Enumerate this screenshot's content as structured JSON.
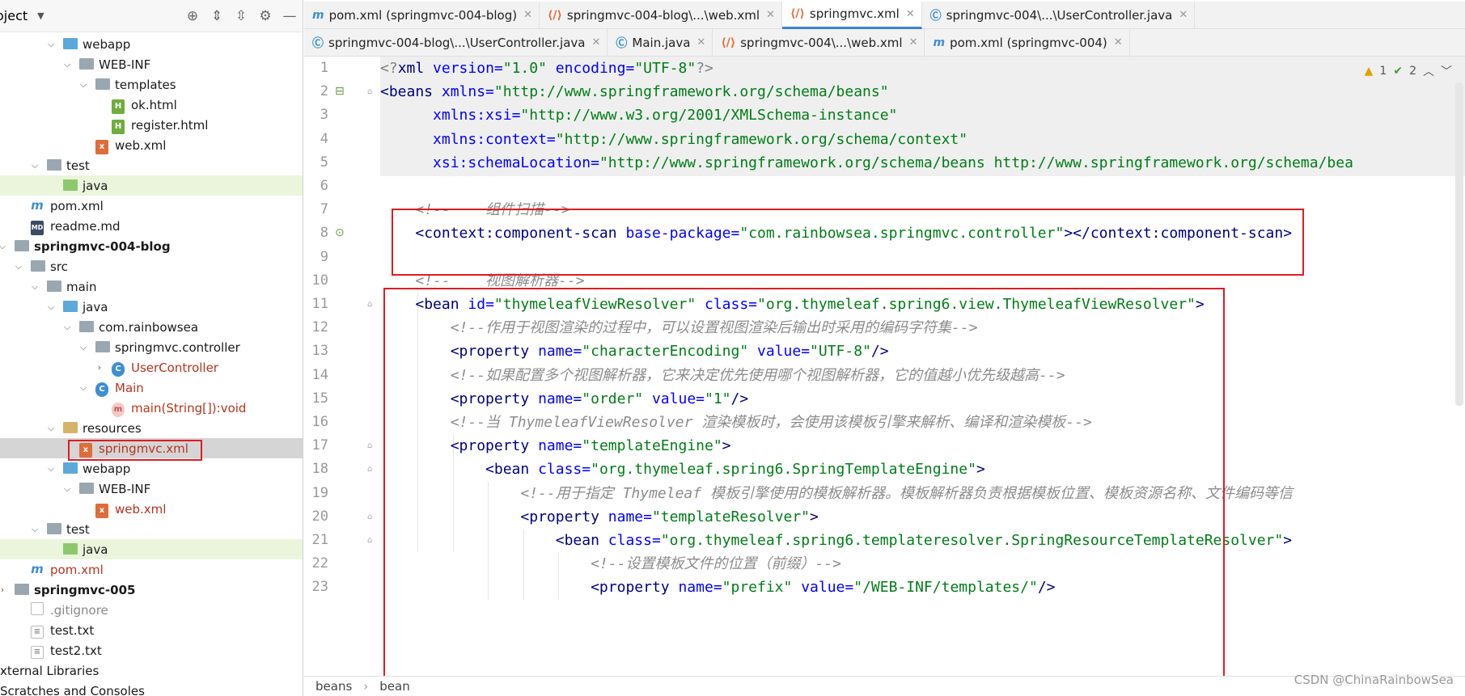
{
  "project_panel": {
    "title": "oject",
    "tree": [
      {
        "label": "webapp",
        "depth": 2,
        "kind": "folder-web",
        "arrow": "open"
      },
      {
        "label": "WEB-INF",
        "depth": 3,
        "kind": "folder",
        "arrow": "open"
      },
      {
        "label": "templates",
        "depth": 4,
        "kind": "folder",
        "arrow": "open"
      },
      {
        "label": "ok.html",
        "depth": 5,
        "kind": "html"
      },
      {
        "label": "register.html",
        "depth": 5,
        "kind": "html"
      },
      {
        "label": "web.xml",
        "depth": 4,
        "kind": "xml"
      },
      {
        "label": "test",
        "depth": 1,
        "kind": "folder",
        "arrow": "open"
      },
      {
        "label": "java",
        "depth": 2,
        "kind": "folder-green",
        "highlight": true
      },
      {
        "label": "pom.xml",
        "depth": 0,
        "kind": "maven"
      },
      {
        "label": "readme.md",
        "depth": 0,
        "kind": "md"
      },
      {
        "label": "springmvc-004-blog",
        "depth": -1,
        "kind": "module",
        "bold": true,
        "arrow": "open"
      },
      {
        "label": "src",
        "depth": 0,
        "kind": "folder",
        "arrow": "open"
      },
      {
        "label": "main",
        "depth": 1,
        "kind": "folder",
        "arrow": "open"
      },
      {
        "label": "java",
        "depth": 2,
        "kind": "folder-blue",
        "arrow": "open"
      },
      {
        "label": "com.rainbowsea",
        "depth": 3,
        "kind": "package",
        "arrow": "open"
      },
      {
        "label": "springmvc.controller",
        "depth": 4,
        "kind": "package",
        "arrow": "open"
      },
      {
        "label": "UserController",
        "depth": 5,
        "kind": "class",
        "red": true,
        "arrow": "closed"
      },
      {
        "label": "Main",
        "depth": 4,
        "kind": "class-main",
        "red": true,
        "arrow": "open"
      },
      {
        "label": "main(String[]):void",
        "depth": 5,
        "kind": "method",
        "red": true
      },
      {
        "label": "resources",
        "depth": 2,
        "kind": "folder-res",
        "arrow": "open"
      },
      {
        "label": "springmvc.xml",
        "depth": 3,
        "kind": "xml",
        "red": true,
        "selected": true
      },
      {
        "label": "webapp",
        "depth": 2,
        "kind": "folder-web",
        "arrow": "open"
      },
      {
        "label": "WEB-INF",
        "depth": 3,
        "kind": "folder",
        "arrow": "open"
      },
      {
        "label": "web.xml",
        "depth": 4,
        "kind": "xml",
        "red": true
      },
      {
        "label": "test",
        "depth": 1,
        "kind": "folder",
        "arrow": "open"
      },
      {
        "label": "java",
        "depth": 2,
        "kind": "folder-green",
        "highlight": true
      },
      {
        "label": "pom.xml",
        "depth": 0,
        "kind": "maven",
        "red": true
      },
      {
        "label": "springmvc-005",
        "depth": -1,
        "kind": "module",
        "bold": true,
        "arrow": "closed"
      },
      {
        "label": ".gitignore",
        "depth": 0,
        "kind": "file",
        "gray": true
      },
      {
        "label": "test.txt",
        "depth": 0,
        "kind": "txt"
      },
      {
        "label": "test2.txt",
        "depth": 0,
        "kind": "txt"
      },
      {
        "label": "xternal Libraries",
        "depth": -1,
        "kind": "none",
        "arrow": "closed"
      },
      {
        "label": "Scratches and Consoles",
        "depth": -1,
        "kind": "none"
      }
    ]
  },
  "tabs_row1": [
    {
      "label": "pom.xml (springmvc-004-blog)",
      "icon": "m"
    },
    {
      "label": "springmvc-004-blog\\...\\web.xml",
      "icon": "x"
    },
    {
      "label": "springmvc.xml",
      "icon": "x",
      "active": true
    },
    {
      "label": "springmvc-004\\...\\UserController.java",
      "icon": "c"
    }
  ],
  "tabs_row2": [
    {
      "label": "springmvc-004-blog\\...\\UserController.java",
      "icon": "c"
    },
    {
      "label": "Main.java",
      "icon": "c"
    },
    {
      "label": "springmvc-004\\...\\web.xml",
      "icon": "x"
    },
    {
      "label": "pom.xml (springmvc-004)",
      "icon": "m"
    }
  ],
  "inspections": {
    "warnings": "1",
    "weak": "2"
  },
  "code_lines": [
    {
      "n": "1",
      "indent": 0,
      "tokens": [
        [
          "pi",
          "<?"
        ],
        [
          "tag",
          "xml "
        ],
        [
          "an",
          "version="
        ],
        [
          "av",
          "\"1.0\""
        ],
        [
          "tag",
          " "
        ],
        [
          "an",
          "encoding="
        ],
        [
          "av",
          "\"UTF-8\""
        ],
        [
          "pi",
          "?>"
        ]
      ]
    },
    {
      "n": "2",
      "indent": 0,
      "tokens": [
        [
          "tag",
          "<beans "
        ],
        [
          "an",
          "xmlns="
        ],
        [
          "av",
          "\"http://www.springframework.org/schema/beans\""
        ]
      ]
    },
    {
      "n": "3",
      "indent": 6,
      "tokens": [
        [
          "an",
          "xmlns:xsi="
        ],
        [
          "av",
          "\"http://www.w3.org/2001/XMLSchema-instance\""
        ]
      ]
    },
    {
      "n": "4",
      "indent": 6,
      "tokens": [
        [
          "an",
          "xmlns:context="
        ],
        [
          "av",
          "\"http://www.springframework.org/schema/context\""
        ]
      ]
    },
    {
      "n": "5",
      "indent": 6,
      "tokens": [
        [
          "an",
          "xsi:schemaLocation="
        ],
        [
          "av",
          "\"http://www.springframework.org/schema/beans http://www.springframework.org/schema/bea"
        ]
      ]
    },
    {
      "n": "6",
      "indent": 0,
      "tokens": []
    },
    {
      "n": "7",
      "indent": 4,
      "tokens": [
        [
          "cm",
          "<!--    组件扫描-->"
        ]
      ]
    },
    {
      "n": "8",
      "indent": 4,
      "tokens": [
        [
          "tag",
          "<context:component-scan "
        ],
        [
          "an",
          "base-package="
        ],
        [
          "av",
          "\"com.rainbowsea.springmvc.controller\""
        ],
        [
          "tag",
          "></context:component-scan>"
        ]
      ]
    },
    {
      "n": "9",
      "indent": 0,
      "tokens": []
    },
    {
      "n": "10",
      "indent": 4,
      "tokens": [
        [
          "cm",
          "<!--    视图解析器-->"
        ]
      ]
    },
    {
      "n": "11",
      "indent": 4,
      "tokens": [
        [
          "tag",
          "<bean "
        ],
        [
          "an",
          "id="
        ],
        [
          "av",
          "\"thymeleafViewResolver\""
        ],
        [
          "tag",
          " "
        ],
        [
          "an",
          "class="
        ],
        [
          "av",
          "\"org.thymeleaf.spring6.view.ThymeleafViewResolver\""
        ],
        [
          "tag",
          ">"
        ]
      ]
    },
    {
      "n": "12",
      "indent": 8,
      "tokens": [
        [
          "cm",
          "<!--作用于视图渲染的过程中，可以设置视图渲染后输出时采用的编码字符集-->"
        ]
      ]
    },
    {
      "n": "13",
      "indent": 8,
      "tokens": [
        [
          "tag",
          "<property "
        ],
        [
          "an",
          "name="
        ],
        [
          "av",
          "\"characterEncoding\""
        ],
        [
          "tag",
          " "
        ],
        [
          "an",
          "value="
        ],
        [
          "av",
          "\"UTF-8\""
        ],
        [
          "tag",
          "/>"
        ]
      ]
    },
    {
      "n": "14",
      "indent": 8,
      "tokens": [
        [
          "cm",
          "<!--如果配置多个视图解析器，它来决定优先使用哪个视图解析器，它的值越小优先级越高-->"
        ]
      ]
    },
    {
      "n": "15",
      "indent": 8,
      "tokens": [
        [
          "tag",
          "<property "
        ],
        [
          "an",
          "name="
        ],
        [
          "av",
          "\"order\""
        ],
        [
          "tag",
          " "
        ],
        [
          "an",
          "value="
        ],
        [
          "av",
          "\"1\""
        ],
        [
          "tag",
          "/>"
        ]
      ]
    },
    {
      "n": "16",
      "indent": 8,
      "tokens": [
        [
          "cm",
          "<!--当 ThymeleafViewResolver 渲染模板时，会使用该模板引擎来解析、编译和渲染模板-->"
        ]
      ]
    },
    {
      "n": "17",
      "indent": 8,
      "tokens": [
        [
          "tag",
          "<property "
        ],
        [
          "an",
          "name="
        ],
        [
          "av",
          "\"templateEngine\""
        ],
        [
          "tag",
          ">"
        ]
      ]
    },
    {
      "n": "18",
      "indent": 12,
      "tokens": [
        [
          "tag",
          "<bean "
        ],
        [
          "an",
          "class="
        ],
        [
          "av",
          "\"org.thymeleaf.spring6.SpringTemplateEngine\""
        ],
        [
          "tag",
          ">"
        ]
      ]
    },
    {
      "n": "19",
      "indent": 16,
      "tokens": [
        [
          "cm",
          "<!--用于指定 Thymeleaf 模板引擎使用的模板解析器。模板解析器负责根据模板位置、模板资源名称、文件编码等信"
        ]
      ]
    },
    {
      "n": "20",
      "indent": 16,
      "tokens": [
        [
          "tag",
          "<property "
        ],
        [
          "an",
          "name="
        ],
        [
          "av",
          "\"templateResolver\""
        ],
        [
          "tag",
          ">"
        ]
      ]
    },
    {
      "n": "21",
      "indent": 20,
      "tokens": [
        [
          "tag",
          "<bean "
        ],
        [
          "an",
          "class="
        ],
        [
          "av",
          "\"org.thymeleaf.spring6.templateresolver.SpringResourceTemplateResolver\""
        ],
        [
          "tag",
          ">"
        ]
      ]
    },
    {
      "n": "22",
      "indent": 24,
      "tokens": [
        [
          "cm",
          "<!--设置模板文件的位置（前缀）-->"
        ]
      ]
    },
    {
      "n": "23",
      "indent": 24,
      "tokens": [
        [
          "tag",
          "<property "
        ],
        [
          "an",
          "name="
        ],
        [
          "av",
          "\"prefix\""
        ],
        [
          "tag",
          " "
        ],
        [
          "an",
          "value="
        ],
        [
          "av",
          "\"/WEB-INF/templates/\""
        ],
        [
          "tag",
          "/>"
        ]
      ]
    }
  ],
  "breadcrumb": [
    "beans",
    "bean"
  ],
  "watermark": "CSDN @ChinaRainbowSea",
  "colors": {
    "accent": "#3b82d6",
    "annotation_box": "#e01b24",
    "tag": "#000080",
    "attr_name": "#0000ff",
    "attr_value": "#007d17",
    "comment": "#8c8c8c"
  }
}
